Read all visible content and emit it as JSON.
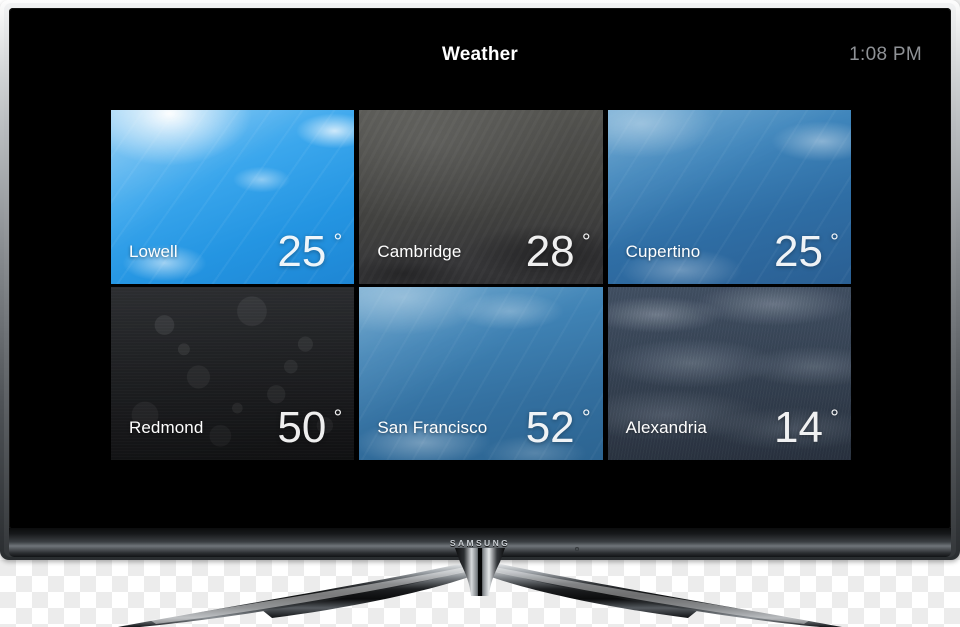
{
  "device": {
    "brand_logo": "SAMSUNG",
    "type": "television",
    "bezel_color": "#8e9296"
  },
  "screen": {
    "background_color": "#000000",
    "status_bar": {
      "title": "Weather",
      "title_color": "#ffffff",
      "clock": "1:08 PM",
      "clock_color": "#8f9296"
    },
    "tiles": [
      {
        "city": "Lowell",
        "temperature": "25",
        "degree_symbol": "°",
        "condition": "sunny-bright",
        "art": "art-sunny-bright"
      },
      {
        "city": "Cambridge",
        "temperature": "28",
        "degree_symbol": "°",
        "condition": "overcast",
        "art": "art-overcast"
      },
      {
        "city": "Cupertino",
        "temperature": "25",
        "degree_symbol": "°",
        "condition": "sunny-deep-blue",
        "art": "art-sunny-deep"
      },
      {
        "city": "Redmond",
        "temperature": "50",
        "degree_symbol": "°",
        "condition": "rain",
        "art": "art-rain"
      },
      {
        "city": "San Francisco",
        "temperature": "52",
        "degree_symbol": "°",
        "condition": "sunny-mid-blue",
        "art": "art-sunny-mid"
      },
      {
        "city": "Alexandria",
        "temperature": "14",
        "degree_symbol": "°",
        "condition": "snow",
        "art": "art-snow"
      }
    ]
  }
}
